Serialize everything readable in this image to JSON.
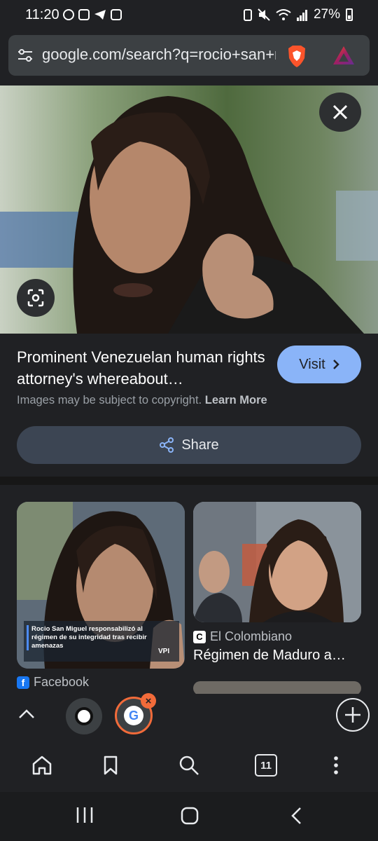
{
  "status_bar": {
    "time": "11:20",
    "battery": "27%"
  },
  "url_bar": {
    "url": "google.com/search?q=rocio+san+miguel"
  },
  "image_viewer": {
    "title": "Prominent Venezuelan human rights attorney's whereabout…",
    "visit_label": "Visit",
    "copyright_text": "Images may be subject to copyright.",
    "learn_more_label": "Learn More",
    "share_label": "Share"
  },
  "related": {
    "items": [
      {
        "caption": "Rocio San Miguel responsabilizó al régimen de su integridad tras recibir amenazas",
        "watermark": "VPI",
        "source": "Facebook",
        "source_icon": "f"
      },
      {
        "source": "El Colombiano",
        "source_icon": "C",
        "title": "Régimen de Maduro a…"
      }
    ]
  },
  "tab_strip": {
    "active_tab_icon": "G"
  },
  "bottom_nav": {
    "tab_count": "11"
  },
  "colors": {
    "background": "#202124",
    "accent_button": "#8ab4f8",
    "active_tab_ring": "#f26b3a"
  }
}
